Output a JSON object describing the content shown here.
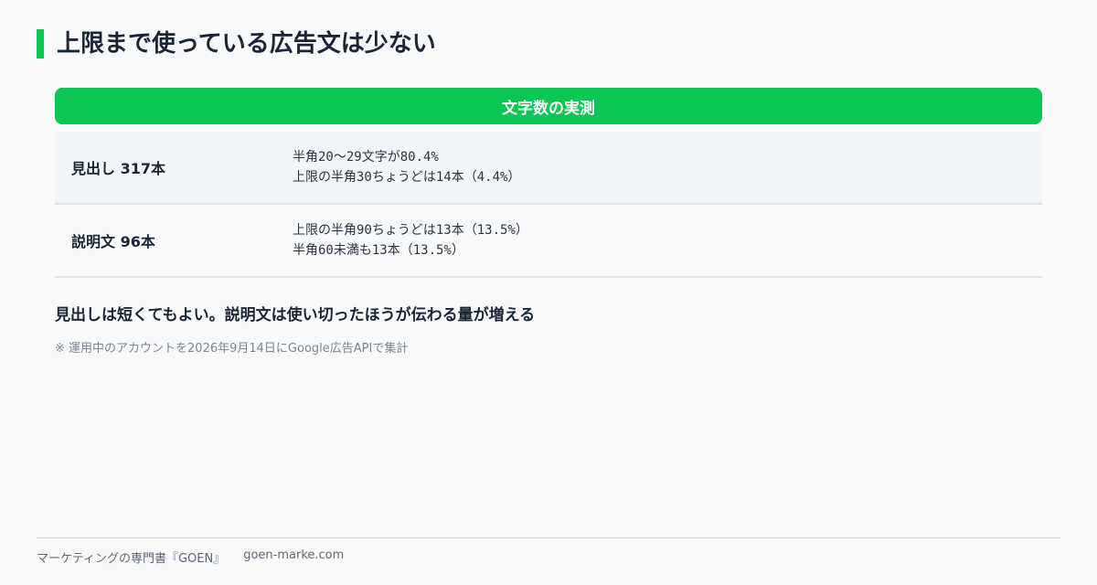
{
  "title": "上限まで使っている広告文は少ない",
  "table": {
    "header": "文字数の実測",
    "rows": [
      {
        "label": "見出し 317本",
        "lines": [
          "半角20〜29文字が80.4%",
          "上限の半角30ちょうどは14本（4.4%）"
        ]
      },
      {
        "label": "説明文 96本",
        "lines": [
          "上限の半角90ちょうどは13本（13.5%）",
          "半角60未満も13本（13.5%）"
        ]
      }
    ]
  },
  "conclusion": "見出しは短くてもよい。説明文は使い切ったほうが伝わる量が増える",
  "note": "※ 運用中のアカウントを2026年9月14日にGoogle広告APIで集計",
  "footer": {
    "book": "マーケティングの専門書『GOEN』",
    "site": "goen-marke.com"
  },
  "colors": {
    "accent": "#0ac653",
    "text": "#1a2536",
    "background": "#f7f9fb"
  }
}
